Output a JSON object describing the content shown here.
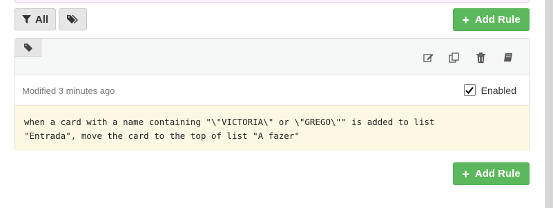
{
  "toolbar": {
    "filter_all_label": "All",
    "add_rule_label": "Add Rule"
  },
  "rule": {
    "modified_text": "Modified 3 minutes ago",
    "enabled_label": "Enabled",
    "enabled": true,
    "description_line1": "when a card with a name containing \"\\\"VICTORIA\\\" or \\\"GREGO\\\"\" is added to list",
    "description_line2": "\"Entrada\", move the card to the top of list \"A fazer\""
  },
  "footer": {
    "add_rule_label": "Add Rule"
  },
  "colors": {
    "primary_green": "#5cb85c",
    "rule_body_bg": "#fcf8e3"
  },
  "icons": {
    "filter": "filter-icon",
    "tags": "tags-icon",
    "tag": "tag-icon",
    "edit": "edit-icon",
    "copy": "copy-icon",
    "delete": "trash-icon",
    "book": "book-icon",
    "plus": "plus-icon"
  }
}
